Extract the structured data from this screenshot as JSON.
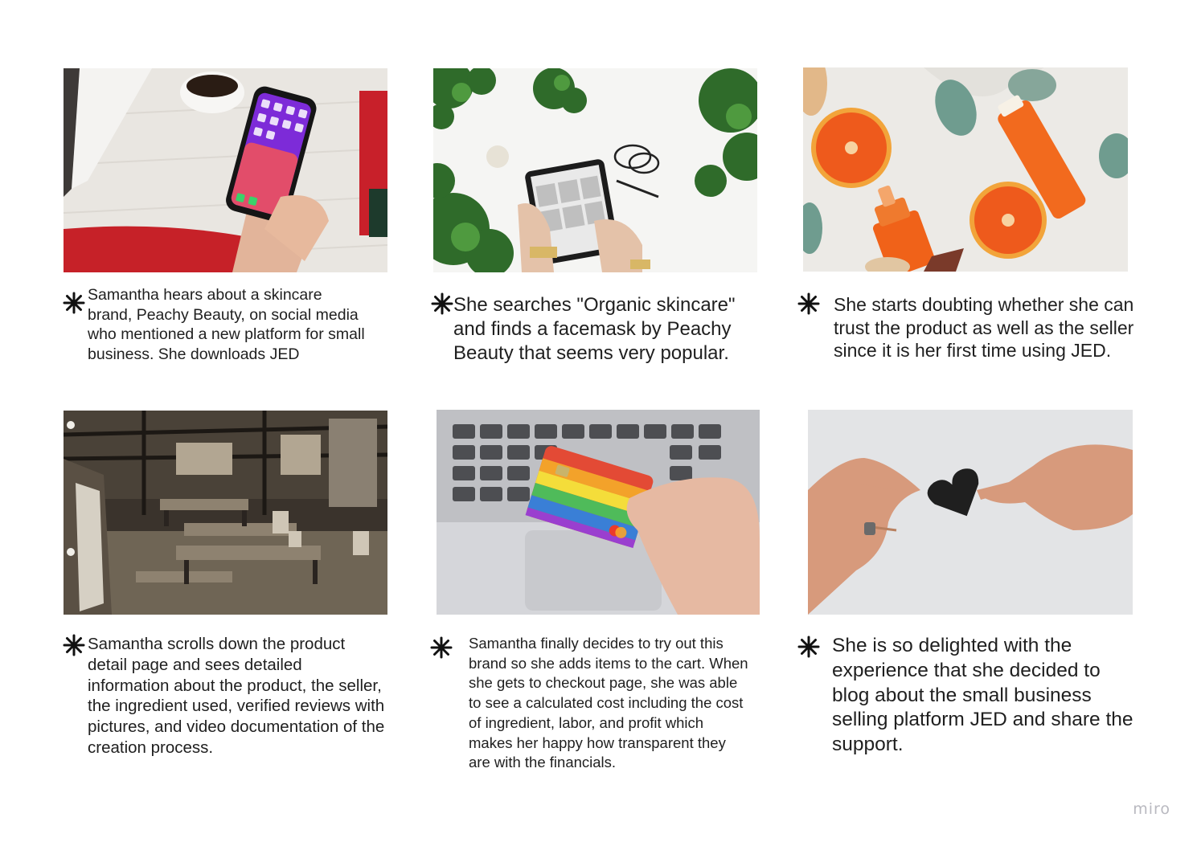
{
  "storyboard": {
    "frames": [
      {
        "image": "phone-in-hand-photo",
        "caption": "Samantha hears about a skincare brand, Peachy Beauty, on social media who mentioned a new platform for small business. She downloads JED"
      },
      {
        "image": "tablet-shopping-photo",
        "caption": "She searches \"Organic skincare\" and finds a facemask by Peachy Beauty that seems very popular."
      },
      {
        "image": "orange-skincare-products-photo",
        "caption": "She starts doubting whether she can trust the product as well as the seller since it is her first time using JED."
      },
      {
        "image": "vintage-workshop-photo",
        "caption": "Samantha scrolls down the product detail page and sees detailed information about the product, the seller, the ingredient used, verified reviews with pictures, and video documentation of the creation process."
      },
      {
        "image": "credit-card-laptop-photo",
        "caption": "Samantha finally decides to try out this brand so she adds items to the cart. When she gets to checkout page, she was able to see a calculated cost including the cost of ingredient, labor, and profit which makes her happy how transparent they are with the financials."
      },
      {
        "image": "hands-sharing-heart-photo",
        "caption": "She is so delighted with the experience that she decided to blog about the small business selling platform JED and share the support."
      }
    ],
    "bullet_icon": "asterisk-icon"
  },
  "watermark": "miro"
}
